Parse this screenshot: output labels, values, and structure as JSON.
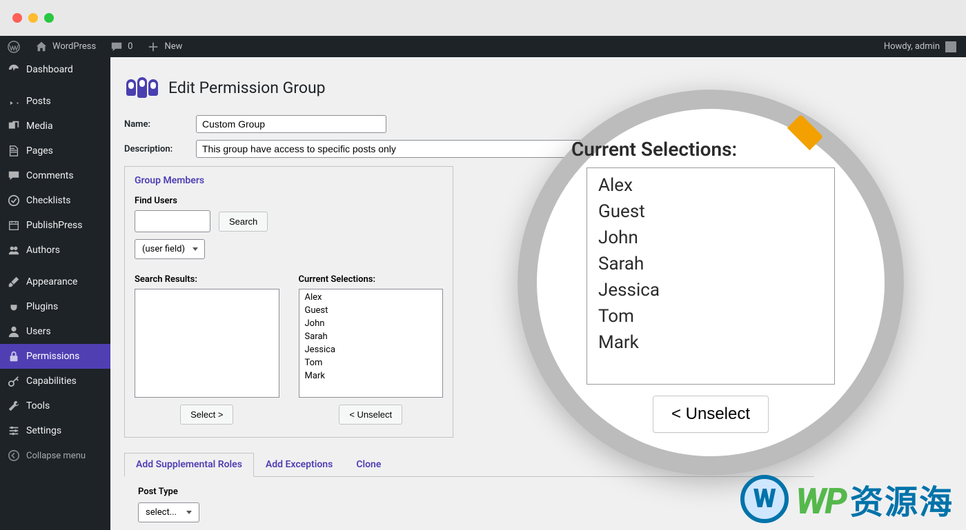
{
  "adminbar": {
    "site_name": "WordPress",
    "comments_count": "0",
    "new_label": "New",
    "howdy": "Howdy, admin"
  },
  "sidebar": {
    "items": [
      {
        "label": "Dashboard",
        "icon": "dashboard"
      },
      {
        "label": "Posts",
        "icon": "pin"
      },
      {
        "label": "Media",
        "icon": "media"
      },
      {
        "label": "Pages",
        "icon": "page"
      },
      {
        "label": "Comments",
        "icon": "comment"
      },
      {
        "label": "Checklists",
        "icon": "check"
      },
      {
        "label": "PublishPress",
        "icon": "calendar"
      },
      {
        "label": "Authors",
        "icon": "groups"
      },
      {
        "label": "Appearance",
        "icon": "brush"
      },
      {
        "label": "Plugins",
        "icon": "plug"
      },
      {
        "label": "Users",
        "icon": "user"
      },
      {
        "label": "Permissions",
        "icon": "lock",
        "active": true
      },
      {
        "label": "Capabilities",
        "icon": "key"
      },
      {
        "label": "Tools",
        "icon": "wrench"
      },
      {
        "label": "Settings",
        "icon": "sliders"
      }
    ],
    "collapse": "Collapse menu"
  },
  "page": {
    "title": "Edit Permission Group",
    "name_label": "Name:",
    "name_value": "Custom Group",
    "desc_label": "Description:",
    "desc_value": "This group have access to specific posts only"
  },
  "group_members": {
    "title": "Group Members",
    "find_label": "Find Users",
    "search_btn": "Search",
    "user_field": "(user field)",
    "results_label": "Search Results:",
    "selections_label": "Current Selections:",
    "select_btn": "Select >",
    "unselect_btn": "< Unselect",
    "selections": [
      "Alex",
      "Guest",
      "John",
      "Sarah",
      "Jessica",
      "Tom",
      "Mark"
    ]
  },
  "tabs": {
    "items": [
      "Add Supplemental Roles",
      "Add Exceptions",
      "Clone"
    ],
    "post_type_label": "Post Type",
    "post_type_value": "select..."
  },
  "magnify": {
    "title": "Current Selections:",
    "items": [
      "Alex",
      "Guest",
      "John",
      "Sarah",
      "Jessica",
      "Tom",
      "Mark"
    ],
    "unselect_btn": "< Unselect"
  },
  "watermark": {
    "wp": "WP",
    "cn": "资源海"
  }
}
